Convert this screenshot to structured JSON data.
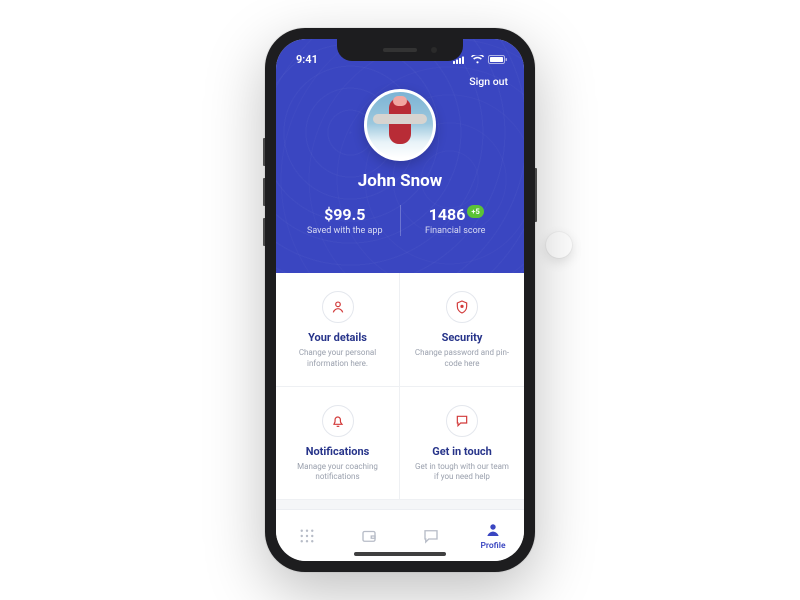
{
  "status": {
    "time": "9:41"
  },
  "header": {
    "sign_out": "Sign out",
    "username": "John Snow",
    "stats": {
      "saved_value": "$99.5",
      "saved_label": "Saved with the app",
      "score_value": "1486",
      "score_delta": "+5",
      "score_label": "Financial score"
    }
  },
  "cards": {
    "details": {
      "title": "Your details",
      "desc": "Change your personal information here."
    },
    "security": {
      "title": "Security",
      "desc": "Change password and pin-code here"
    },
    "notifications": {
      "title": "Notifications",
      "desc": "Manage your coaching notifications"
    },
    "contact": {
      "title": "Get in touch",
      "desc": "Get in tough with our team if you need help"
    }
  },
  "tabs": {
    "profile_label": "Profile"
  }
}
